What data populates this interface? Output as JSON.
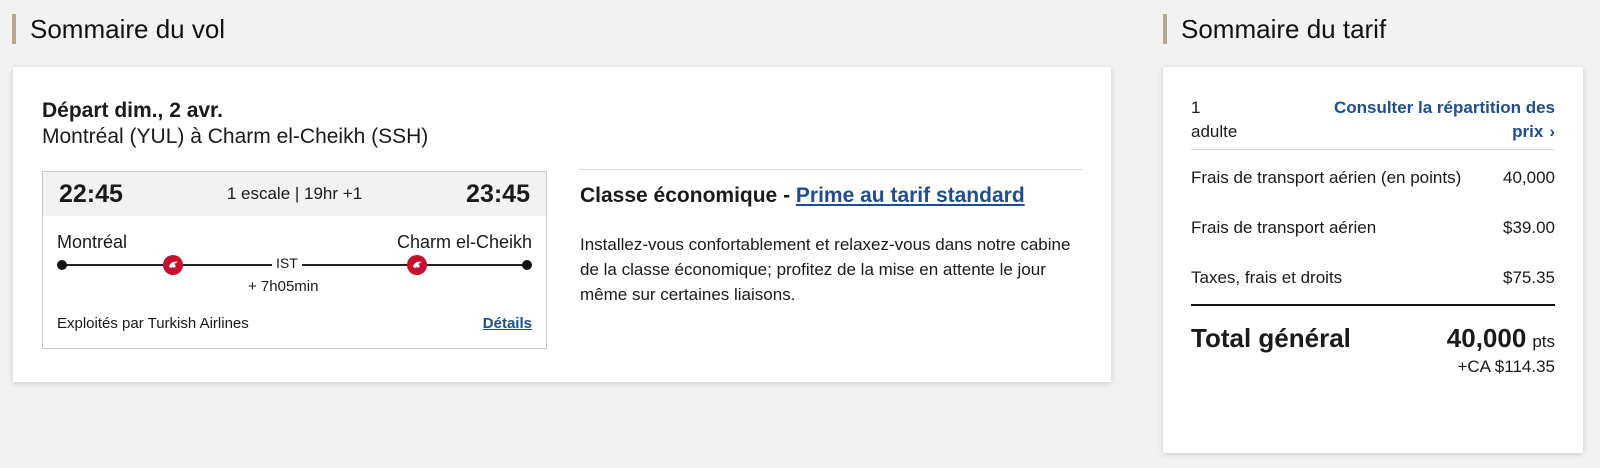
{
  "flight_summary": {
    "title": "Sommaire du vol",
    "departure": "Départ dim., 2 avr.",
    "route": "Montréal (YUL) à Charm el-Cheikh (SSH)",
    "segment": {
      "dep_time": "22:45",
      "arr_time": "23:45",
      "stops": "1 escale | 19hr +1",
      "from_city": "Montréal",
      "to_city": "Charm el-Cheikh",
      "stop_code": "IST",
      "layover": "+ 7h05min",
      "operated_by": "Exploités par Turkish Airlines",
      "details_link": "Détails",
      "airline_logo_icon": "turkish-airlines-logo",
      "logo_color": "#c8102e"
    },
    "cabin_prefix": "Classe économique - ",
    "cabin_link": "Prime au tarif standard",
    "cabin_description": "Installez-vous confortablement et relaxez-vous dans notre cabine de la classe économique; profitez de la mise en attente le jour même sur certaines liaisons."
  },
  "fare_summary": {
    "title": "Sommaire du tarif",
    "passengers_count": "1",
    "passengers_label": "adulte",
    "breakdown_link": "Consulter la répartition des prix",
    "breakdown_icon": "chevron-right-icon",
    "rows": [
      {
        "label": "Frais de transport aérien (en points)",
        "value": "40,000"
      },
      {
        "label": "Frais de transport aérien",
        "value": "$39.00"
      },
      {
        "label": "Taxes, frais et droits",
        "value": "$75.35"
      }
    ],
    "total_label": "Total général",
    "total_points": "40,000",
    "total_points_unit": "pts",
    "total_cash": "+CA $114.35"
  },
  "colors": {
    "link": "#1f4e8c",
    "accent_bar": "#b9a98c",
    "page_bg": "#f2f2f2"
  }
}
